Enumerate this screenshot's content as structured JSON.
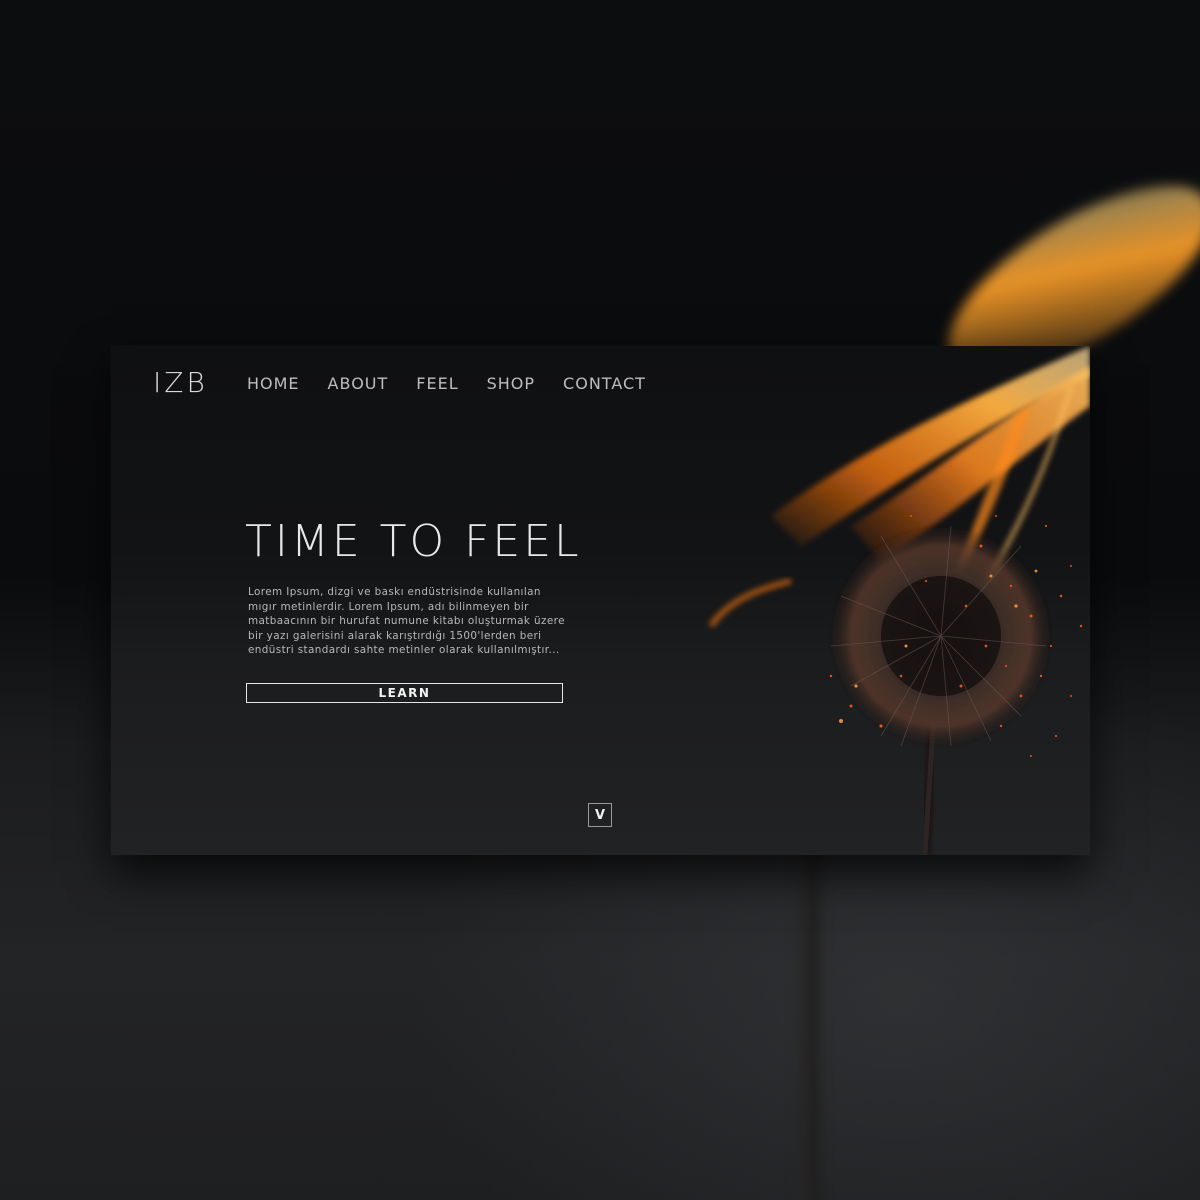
{
  "header": {
    "logo": "IZB",
    "nav": [
      "HOME",
      "ABOUT",
      "FEEL",
      "SHOP",
      "CONTACT"
    ]
  },
  "hero": {
    "title": "TIME TO FEEL",
    "body": "Lorem Ipsum, dizgi ve baskı endüstrisinde kullanılan mıgır metinlerdir. Lorem Ipsum, adı bilinmeyen bir matbaacının bir hurufat numune kitabı oluşturmak üzere bir yazı galerisini alarak karıştırdığı 1500'lerden beri endüstri standardı sahte metinler olarak kullanılmıştır...",
    "cta_label": "LEARN",
    "scroll_label": "V"
  },
  "imagery": {
    "subject": "burning dandelion seed head",
    "flame_color": "#ff8c1a",
    "ember_color": "#e0521c",
    "background_color": "#0f1012"
  }
}
